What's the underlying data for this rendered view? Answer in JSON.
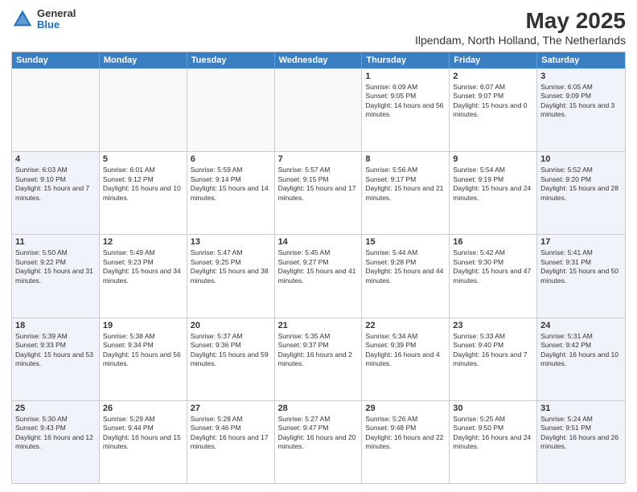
{
  "header": {
    "logo_general": "General",
    "logo_blue": "Blue",
    "title": "May 2025",
    "subtitle": "Ilpendam, North Holland, The Netherlands"
  },
  "days_of_week": [
    "Sunday",
    "Monday",
    "Tuesday",
    "Wednesday",
    "Thursday",
    "Friday",
    "Saturday"
  ],
  "weeks": [
    [
      {
        "day": "",
        "empty": true
      },
      {
        "day": "",
        "empty": true
      },
      {
        "day": "",
        "empty": true
      },
      {
        "day": "",
        "empty": true
      },
      {
        "day": "1",
        "sunrise": "Sunrise: 6:09 AM",
        "sunset": "Sunset: 9:05 PM",
        "daylight": "Daylight: 14 hours and 56 minutes."
      },
      {
        "day": "2",
        "sunrise": "Sunrise: 6:07 AM",
        "sunset": "Sunset: 9:07 PM",
        "daylight": "Daylight: 15 hours and 0 minutes."
      },
      {
        "day": "3",
        "sunrise": "Sunrise: 6:05 AM",
        "sunset": "Sunset: 9:09 PM",
        "daylight": "Daylight: 15 hours and 3 minutes.",
        "weekend": true
      }
    ],
    [
      {
        "day": "4",
        "sunrise": "Sunrise: 6:03 AM",
        "sunset": "Sunset: 9:10 PM",
        "daylight": "Daylight: 15 hours and 7 minutes.",
        "weekend": true
      },
      {
        "day": "5",
        "sunrise": "Sunrise: 6:01 AM",
        "sunset": "Sunset: 9:12 PM",
        "daylight": "Daylight: 15 hours and 10 minutes."
      },
      {
        "day": "6",
        "sunrise": "Sunrise: 5:59 AM",
        "sunset": "Sunset: 9:14 PM",
        "daylight": "Daylight: 15 hours and 14 minutes."
      },
      {
        "day": "7",
        "sunrise": "Sunrise: 5:57 AM",
        "sunset": "Sunset: 9:15 PM",
        "daylight": "Daylight: 15 hours and 17 minutes."
      },
      {
        "day": "8",
        "sunrise": "Sunrise: 5:56 AM",
        "sunset": "Sunset: 9:17 PM",
        "daylight": "Daylight: 15 hours and 21 minutes."
      },
      {
        "day": "9",
        "sunrise": "Sunrise: 5:54 AM",
        "sunset": "Sunset: 9:19 PM",
        "daylight": "Daylight: 15 hours and 24 minutes."
      },
      {
        "day": "10",
        "sunrise": "Sunrise: 5:52 AM",
        "sunset": "Sunset: 9:20 PM",
        "daylight": "Daylight: 15 hours and 28 minutes.",
        "weekend": true
      }
    ],
    [
      {
        "day": "11",
        "sunrise": "Sunrise: 5:50 AM",
        "sunset": "Sunset: 9:22 PM",
        "daylight": "Daylight: 15 hours and 31 minutes.",
        "weekend": true
      },
      {
        "day": "12",
        "sunrise": "Sunrise: 5:49 AM",
        "sunset": "Sunset: 9:23 PM",
        "daylight": "Daylight: 15 hours and 34 minutes."
      },
      {
        "day": "13",
        "sunrise": "Sunrise: 5:47 AM",
        "sunset": "Sunset: 9:25 PM",
        "daylight": "Daylight: 15 hours and 38 minutes."
      },
      {
        "day": "14",
        "sunrise": "Sunrise: 5:45 AM",
        "sunset": "Sunset: 9:27 PM",
        "daylight": "Daylight: 15 hours and 41 minutes."
      },
      {
        "day": "15",
        "sunrise": "Sunrise: 5:44 AM",
        "sunset": "Sunset: 9:28 PM",
        "daylight": "Daylight: 15 hours and 44 minutes."
      },
      {
        "day": "16",
        "sunrise": "Sunrise: 5:42 AM",
        "sunset": "Sunset: 9:30 PM",
        "daylight": "Daylight: 15 hours and 47 minutes."
      },
      {
        "day": "17",
        "sunrise": "Sunrise: 5:41 AM",
        "sunset": "Sunset: 9:31 PM",
        "daylight": "Daylight: 15 hours and 50 minutes.",
        "weekend": true
      }
    ],
    [
      {
        "day": "18",
        "sunrise": "Sunrise: 5:39 AM",
        "sunset": "Sunset: 9:33 PM",
        "daylight": "Daylight: 15 hours and 53 minutes.",
        "weekend": true
      },
      {
        "day": "19",
        "sunrise": "Sunrise: 5:38 AM",
        "sunset": "Sunset: 9:34 PM",
        "daylight": "Daylight: 15 hours and 56 minutes."
      },
      {
        "day": "20",
        "sunrise": "Sunrise: 5:37 AM",
        "sunset": "Sunset: 9:36 PM",
        "daylight": "Daylight: 15 hours and 59 minutes."
      },
      {
        "day": "21",
        "sunrise": "Sunrise: 5:35 AM",
        "sunset": "Sunset: 9:37 PM",
        "daylight": "Daylight: 16 hours and 2 minutes."
      },
      {
        "day": "22",
        "sunrise": "Sunrise: 5:34 AM",
        "sunset": "Sunset: 9:39 PM",
        "daylight": "Daylight: 16 hours and 4 minutes."
      },
      {
        "day": "23",
        "sunrise": "Sunrise: 5:33 AM",
        "sunset": "Sunset: 9:40 PM",
        "daylight": "Daylight: 16 hours and 7 minutes."
      },
      {
        "day": "24",
        "sunrise": "Sunrise: 5:31 AM",
        "sunset": "Sunset: 9:42 PM",
        "daylight": "Daylight: 16 hours and 10 minutes.",
        "weekend": true
      }
    ],
    [
      {
        "day": "25",
        "sunrise": "Sunrise: 5:30 AM",
        "sunset": "Sunset: 9:43 PM",
        "daylight": "Daylight: 16 hours and 12 minutes.",
        "weekend": true
      },
      {
        "day": "26",
        "sunrise": "Sunrise: 5:29 AM",
        "sunset": "Sunset: 9:44 PM",
        "daylight": "Daylight: 16 hours and 15 minutes."
      },
      {
        "day": "27",
        "sunrise": "Sunrise: 5:28 AM",
        "sunset": "Sunset: 9:46 PM",
        "daylight": "Daylight: 16 hours and 17 minutes."
      },
      {
        "day": "28",
        "sunrise": "Sunrise: 5:27 AM",
        "sunset": "Sunset: 9:47 PM",
        "daylight": "Daylight: 16 hours and 20 minutes."
      },
      {
        "day": "29",
        "sunrise": "Sunrise: 5:26 AM",
        "sunset": "Sunset: 9:48 PM",
        "daylight": "Daylight: 16 hours and 22 minutes."
      },
      {
        "day": "30",
        "sunrise": "Sunrise: 5:25 AM",
        "sunset": "Sunset: 9:50 PM",
        "daylight": "Daylight: 16 hours and 24 minutes."
      },
      {
        "day": "31",
        "sunrise": "Sunrise: 5:24 AM",
        "sunset": "Sunset: 9:51 PM",
        "daylight": "Daylight: 16 hours and 26 minutes.",
        "weekend": true
      }
    ]
  ]
}
